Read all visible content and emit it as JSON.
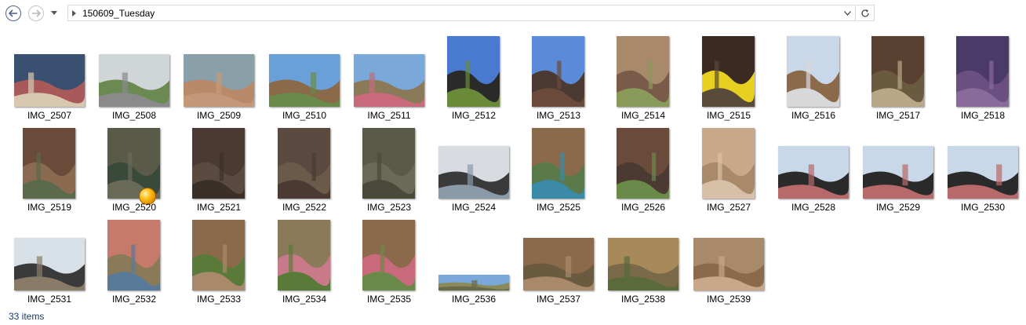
{
  "address": {
    "path": "150609_Tuesday"
  },
  "status": {
    "item_count": "33 items"
  },
  "items": [
    {
      "name": "IMG_2507",
      "shape": "land",
      "colors": [
        "#3a5070",
        "#a85a5a",
        "#d8c8b0"
      ]
    },
    {
      "name": "IMG_2508",
      "shape": "land",
      "colors": [
        "#d0d6d8",
        "#6a8a52",
        "#8a8a8a"
      ]
    },
    {
      "name": "IMG_2509",
      "shape": "land",
      "colors": [
        "#8aa0a8",
        "#b88a6a",
        "#c49878"
      ]
    },
    {
      "name": "IMG_2510",
      "shape": "land",
      "colors": [
        "#6aa0d8",
        "#8a6a48",
        "#6a8a4a"
      ]
    },
    {
      "name": "IMG_2511",
      "shape": "land",
      "colors": [
        "#7aa8d8",
        "#8a7a5a",
        "#c86a7a"
      ]
    },
    {
      "name": "IMG_2512",
      "shape": "port",
      "colors": [
        "#4a7ad0",
        "#2a2a2a",
        "#6a8a3a"
      ]
    },
    {
      "name": "IMG_2513",
      "shape": "port",
      "colors": [
        "#5a8ad8",
        "#4a3a32",
        "#6a4a3a"
      ]
    },
    {
      "name": "IMG_2514",
      "shape": "port",
      "colors": [
        "#a88a6a",
        "#7a5a48",
        "#8a9a5a"
      ]
    },
    {
      "name": "IMG_2515",
      "shape": "port",
      "colors": [
        "#3a2a22",
        "#e8d020",
        "#5a4a3a"
      ]
    },
    {
      "name": "IMG_2516",
      "shape": "port",
      "colors": [
        "#c8d8e8",
        "#8a6a4a",
        "#d8d8d8"
      ]
    },
    {
      "name": "IMG_2517",
      "shape": "port",
      "colors": [
        "#5a4030",
        "#6a5a40",
        "#b8a888"
      ]
    },
    {
      "name": "IMG_2518",
      "shape": "port",
      "colors": [
        "#4a3a68",
        "#6a5080",
        "#8a6a9a"
      ]
    },
    {
      "name": "IMG_2519",
      "shape": "port",
      "colors": [
        "#6a4a38",
        "#8a6a50",
        "#5a6a4a"
      ]
    },
    {
      "name": "IMG_2520",
      "shape": "port",
      "colors": [
        "#5a5a48",
        "#3a4a3a",
        "#6a6a58"
      ],
      "badge": true
    },
    {
      "name": "IMG_2521",
      "shape": "port",
      "colors": [
        "#4a3a32",
        "#5a4a40",
        "#3a3028"
      ]
    },
    {
      "name": "IMG_2522",
      "shape": "port",
      "colors": [
        "#5a4a40",
        "#6a5a4a",
        "#4a3a32"
      ]
    },
    {
      "name": "IMG_2523",
      "shape": "port",
      "colors": [
        "#5a5a48",
        "#6a6a58",
        "#4a4a3a"
      ]
    },
    {
      "name": "IMG_2524",
      "shape": "land",
      "colors": [
        "#d8dce0",
        "#3a3a3a",
        "#8a9aa8"
      ]
    },
    {
      "name": "IMG_2525",
      "shape": "port",
      "colors": [
        "#8a6a4a",
        "#5a7a4a",
        "#3a8aa8"
      ]
    },
    {
      "name": "IMG_2526",
      "shape": "port",
      "colors": [
        "#6a4a3a",
        "#4a3a32",
        "#6a8a4a"
      ]
    },
    {
      "name": "IMG_2527",
      "shape": "port",
      "colors": [
        "#c8a888",
        "#a88a6a",
        "#d8c0a8"
      ]
    },
    {
      "name": "IMG_2528",
      "shape": "land",
      "colors": [
        "#c8d8e8",
        "#2a2a2a",
        "#b86a6a"
      ]
    },
    {
      "name": "IMG_2529",
      "shape": "land",
      "colors": [
        "#c8d8e8",
        "#2a2a2a",
        "#b86a6a"
      ]
    },
    {
      "name": "IMG_2530",
      "shape": "land",
      "colors": [
        "#c8d8e8",
        "#2a2a2a",
        "#b86a6a"
      ]
    },
    {
      "name": "IMG_2531",
      "shape": "land",
      "colors": [
        "#d8e0e8",
        "#3a3a3a",
        "#8a7a68"
      ]
    },
    {
      "name": "IMG_2532",
      "shape": "port",
      "colors": [
        "#c87a6a",
        "#8a7a5a",
        "#5a7a9a"
      ]
    },
    {
      "name": "IMG_2533",
      "shape": "port",
      "colors": [
        "#8a6a4a",
        "#5a7a3a",
        "#a88a6a"
      ]
    },
    {
      "name": "IMG_2534",
      "shape": "port",
      "colors": [
        "#8a7a5a",
        "#c87a8a",
        "#5a7a3a"
      ]
    },
    {
      "name": "IMG_2535",
      "shape": "port",
      "colors": [
        "#8a6a4a",
        "#c86a7a",
        "#6a8a4a"
      ]
    },
    {
      "name": "IMG_2536",
      "shape": "pano",
      "colors": [
        "#7aa8d8",
        "#8a8a5a",
        "#6a6a48"
      ]
    },
    {
      "name": "IMG_2537",
      "shape": "land",
      "colors": [
        "#8a6a4a",
        "#6a5a40",
        "#a88a6a"
      ]
    },
    {
      "name": "IMG_2538",
      "shape": "land",
      "colors": [
        "#a88a5a",
        "#7a6a4a",
        "#5a6a3a"
      ]
    },
    {
      "name": "IMG_2539",
      "shape": "land",
      "colors": [
        "#a88a6a",
        "#8a6a4a",
        "#c8a888"
      ]
    }
  ]
}
